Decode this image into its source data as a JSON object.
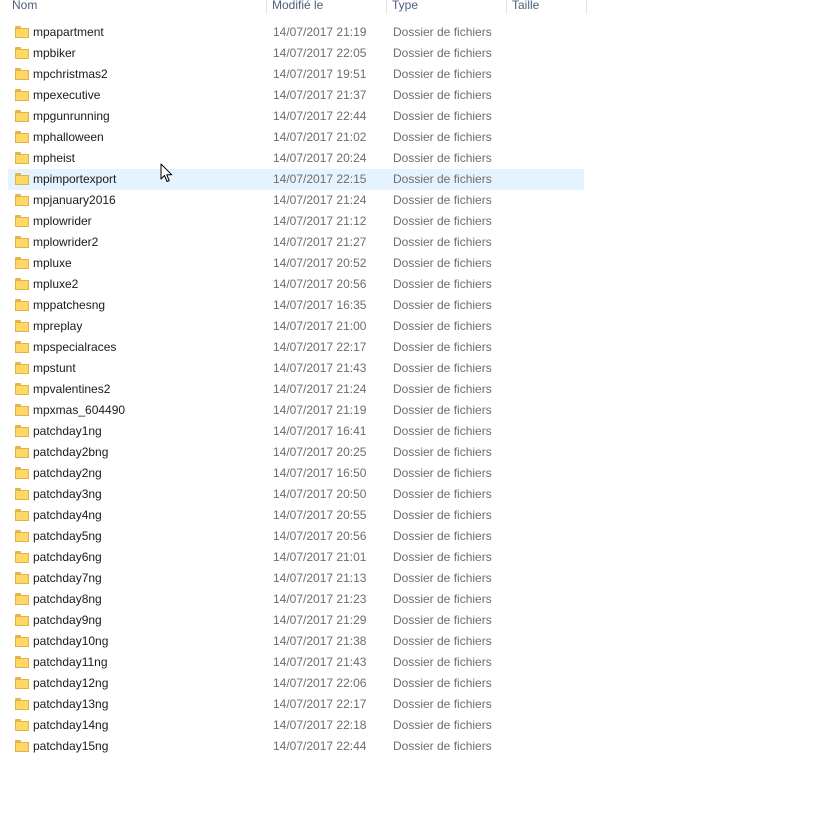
{
  "columns": {
    "name": "Nom",
    "modified": "Modifié le",
    "type": "Type",
    "size": "Taille"
  },
  "hover_index": 7,
  "icon": "folder-icon",
  "rows": [
    {
      "name": "mpapartment",
      "modified": "14/07/2017 21:19",
      "type": "Dossier de fichiers"
    },
    {
      "name": "mpbiker",
      "modified": "14/07/2017 22:05",
      "type": "Dossier de fichiers"
    },
    {
      "name": "mpchristmas2",
      "modified": "14/07/2017 19:51",
      "type": "Dossier de fichiers"
    },
    {
      "name": "mpexecutive",
      "modified": "14/07/2017 21:37",
      "type": "Dossier de fichiers"
    },
    {
      "name": "mpgunrunning",
      "modified": "14/07/2017 22:44",
      "type": "Dossier de fichiers"
    },
    {
      "name": "mphalloween",
      "modified": "14/07/2017 21:02",
      "type": "Dossier de fichiers"
    },
    {
      "name": "mpheist",
      "modified": "14/07/2017 20:24",
      "type": "Dossier de fichiers"
    },
    {
      "name": "mpimportexport",
      "modified": "14/07/2017 22:15",
      "type": "Dossier de fichiers"
    },
    {
      "name": "mpjanuary2016",
      "modified": "14/07/2017 21:24",
      "type": "Dossier de fichiers"
    },
    {
      "name": "mplowrider",
      "modified": "14/07/2017 21:12",
      "type": "Dossier de fichiers"
    },
    {
      "name": "mplowrider2",
      "modified": "14/07/2017 21:27",
      "type": "Dossier de fichiers"
    },
    {
      "name": "mpluxe",
      "modified": "14/07/2017 20:52",
      "type": "Dossier de fichiers"
    },
    {
      "name": "mpluxe2",
      "modified": "14/07/2017 20:56",
      "type": "Dossier de fichiers"
    },
    {
      "name": "mppatchesng",
      "modified": "14/07/2017 16:35",
      "type": "Dossier de fichiers"
    },
    {
      "name": "mpreplay",
      "modified": "14/07/2017 21:00",
      "type": "Dossier de fichiers"
    },
    {
      "name": "mpspecialraces",
      "modified": "14/07/2017 22:17",
      "type": "Dossier de fichiers"
    },
    {
      "name": "mpstunt",
      "modified": "14/07/2017 21:43",
      "type": "Dossier de fichiers"
    },
    {
      "name": "mpvalentines2",
      "modified": "14/07/2017 21:24",
      "type": "Dossier de fichiers"
    },
    {
      "name": "mpxmas_604490",
      "modified": "14/07/2017 21:19",
      "type": "Dossier de fichiers"
    },
    {
      "name": "patchday1ng",
      "modified": "14/07/2017 16:41",
      "type": "Dossier de fichiers"
    },
    {
      "name": "patchday2bng",
      "modified": "14/07/2017 20:25",
      "type": "Dossier de fichiers"
    },
    {
      "name": "patchday2ng",
      "modified": "14/07/2017 16:50",
      "type": "Dossier de fichiers"
    },
    {
      "name": "patchday3ng",
      "modified": "14/07/2017 20:50",
      "type": "Dossier de fichiers"
    },
    {
      "name": "patchday4ng",
      "modified": "14/07/2017 20:55",
      "type": "Dossier de fichiers"
    },
    {
      "name": "patchday5ng",
      "modified": "14/07/2017 20:56",
      "type": "Dossier de fichiers"
    },
    {
      "name": "patchday6ng",
      "modified": "14/07/2017 21:01",
      "type": "Dossier de fichiers"
    },
    {
      "name": "patchday7ng",
      "modified": "14/07/2017 21:13",
      "type": "Dossier de fichiers"
    },
    {
      "name": "patchday8ng",
      "modified": "14/07/2017 21:23",
      "type": "Dossier de fichiers"
    },
    {
      "name": "patchday9ng",
      "modified": "14/07/2017 21:29",
      "type": "Dossier de fichiers"
    },
    {
      "name": "patchday10ng",
      "modified": "14/07/2017 21:38",
      "type": "Dossier de fichiers"
    },
    {
      "name": "patchday11ng",
      "modified": "14/07/2017 21:43",
      "type": "Dossier de fichiers"
    },
    {
      "name": "patchday12ng",
      "modified": "14/07/2017 22:06",
      "type": "Dossier de fichiers"
    },
    {
      "name": "patchday13ng",
      "modified": "14/07/2017 22:17",
      "type": "Dossier de fichiers"
    },
    {
      "name": "patchday14ng",
      "modified": "14/07/2017 22:18",
      "type": "Dossier de fichiers"
    },
    {
      "name": "patchday15ng",
      "modified": "14/07/2017 22:44",
      "type": "Dossier de fichiers"
    }
  ]
}
